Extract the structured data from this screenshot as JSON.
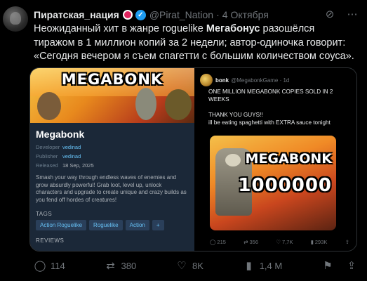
{
  "post": {
    "author_name": "Пиратская_нация",
    "author_handle": "@Pirat_Nation",
    "separator": "·",
    "date": "4 Октября",
    "text_prefix": "Неожиданный хит в жанре roguelike ",
    "text_bold": "Мегабонус",
    "text_suffix": " разошёлся тиражом в 1 миллион копий за 2 недели; автор-одиночка говорит: «Сегодня вечером я съем спагетти с большим количеством соуса».",
    "icons": [
      "grok-icon",
      "more-icon"
    ]
  },
  "steam": {
    "capsule_logo": "MEGABONK",
    "title": "Megabonk",
    "meta": [
      {
        "key": "Developer",
        "value": "vedinad"
      },
      {
        "key": "Publisher",
        "value": "vedinad"
      },
      {
        "key": "Released",
        "value": "18 Sep, 2025"
      }
    ],
    "description": "Smash your way through endless waves of enemies and grow absurdly powerful! Grab loot, level up, unlock characters and upgrade to create unique and crazy builds as you fend off hordes of creatures!",
    "tags_heading": "TAGS",
    "tags": [
      "Action Roguelike",
      "Roguelike",
      "Action",
      "+"
    ],
    "reviews_heading": "REVIEWS"
  },
  "quoted": {
    "name": "bonk",
    "handle": "@MegabonkGame · 1d",
    "line1": "ONE MILLION MEGABONK COPIES SOLD IN 2 WEEKS",
    "line2": "THANK YOU GUYS!!",
    "line3": "ill be eating spaghetti with EXTRA sauce tonight",
    "image_title": "MEGABONK",
    "image_number": "1000000",
    "stats": [
      "215",
      "356",
      "7,7K",
      "293K"
    ]
  },
  "actions": {
    "replies": "114",
    "reposts": "380",
    "likes": "8K",
    "views": "1,4 M"
  }
}
